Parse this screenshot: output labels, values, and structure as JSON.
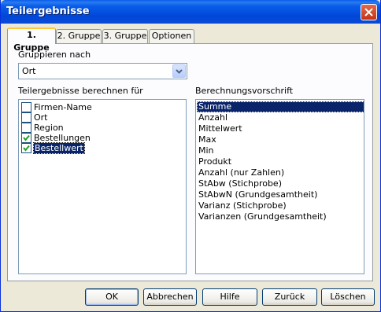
{
  "window": {
    "title": "Teilergebnisse"
  },
  "tabs": [
    {
      "label": "1. Gruppe",
      "active": true
    },
    {
      "label": "2. Gruppe",
      "active": false
    },
    {
      "label": "3. Gruppe",
      "active": false
    },
    {
      "label": "Optionen",
      "active": false
    }
  ],
  "group_by": {
    "label": "Gruppieren nach",
    "value": "Ort"
  },
  "subtotals_for": {
    "label": "Teilergebnisse berechnen für",
    "items": [
      {
        "label": "Firmen-Name",
        "checked": false
      },
      {
        "label": "Ort",
        "checked": false
      },
      {
        "label": "Region",
        "checked": false
      },
      {
        "label": "Bestellungen",
        "checked": true
      },
      {
        "label": "Bestellwert",
        "checked": true
      }
    ]
  },
  "calculation": {
    "label": "Berechnungsvorschrift",
    "items": [
      "Summe",
      "Anzahl",
      "Mittelwert",
      "Max",
      "Min",
      "Produkt",
      "Anzahl (nur Zahlen)",
      "StAbw (Stichprobe)",
      "StAbwN (Grundgesamtheit)",
      "Varianz (Stichprobe)",
      "Varianzen (Grundgesamtheit)"
    ],
    "selected": "Summe"
  },
  "buttons": {
    "ok": "OK",
    "cancel": "Abbrechen",
    "help": "Hilfe",
    "back": "Zurück",
    "delete": "Löschen"
  },
  "colors": {
    "titlebar": "#0a5de9",
    "selection": "#0a246a",
    "face": "#ece9d8",
    "tab_highlight": "#ffc83c"
  }
}
